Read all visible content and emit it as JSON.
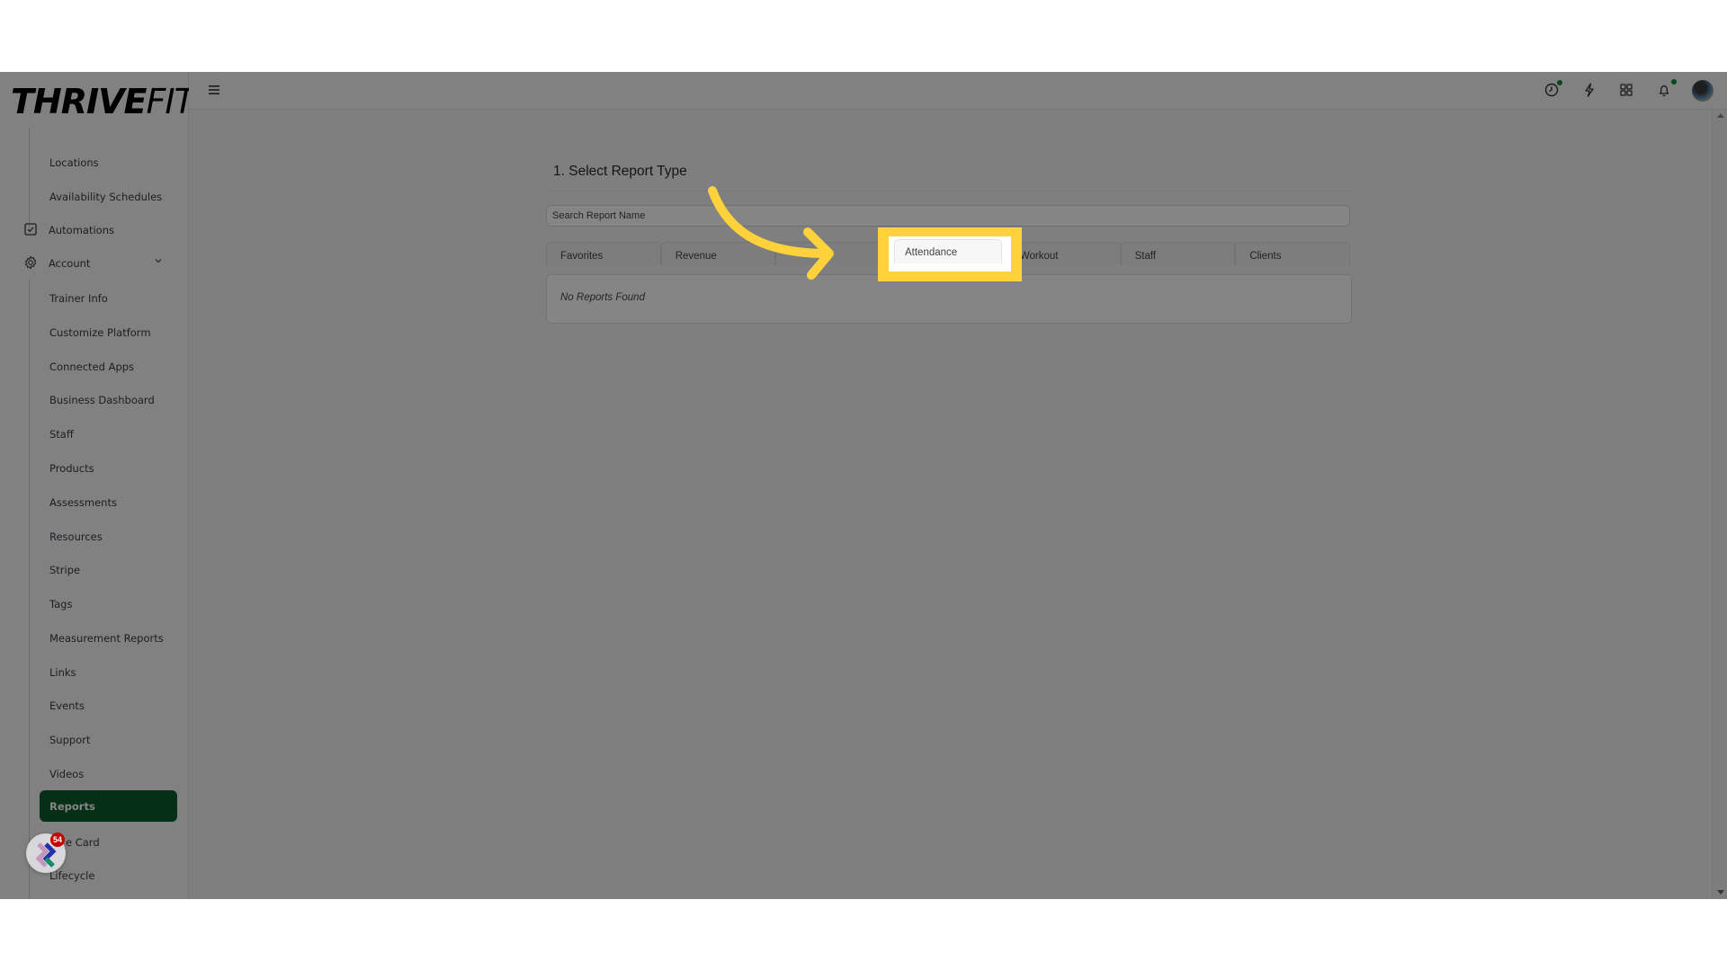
{
  "brand": {
    "name_bold": "THRIVE",
    "name_thin": "FIT"
  },
  "sidebar": {
    "items": [
      {
        "label": "Locations",
        "level": "sub"
      },
      {
        "label": "Availability Schedules",
        "level": "sub"
      },
      {
        "label": "Automations",
        "level": "top",
        "icon": "checkbox-icon"
      },
      {
        "label": "Account",
        "level": "top",
        "icon": "gear-icon",
        "expanded": true
      },
      {
        "label": "Trainer Info",
        "level": "sub"
      },
      {
        "label": "Customize Platform",
        "level": "sub"
      },
      {
        "label": "Connected Apps",
        "level": "sub"
      },
      {
        "label": "Business Dashboard",
        "level": "sub"
      },
      {
        "label": "Staff",
        "level": "sub"
      },
      {
        "label": "Products",
        "level": "sub"
      },
      {
        "label": "Assessments",
        "level": "sub"
      },
      {
        "label": "Resources",
        "level": "sub"
      },
      {
        "label": "Stripe",
        "level": "sub"
      },
      {
        "label": "Tags",
        "level": "sub"
      },
      {
        "label": "Measurement Reports",
        "level": "sub"
      },
      {
        "label": "Links",
        "level": "sub"
      },
      {
        "label": "Events",
        "level": "sub"
      },
      {
        "label": "Support",
        "level": "sub"
      },
      {
        "label": "Videos",
        "level": "sub"
      },
      {
        "label": "Reports",
        "level": "sub",
        "active": true
      },
      {
        "label": "e Card",
        "level": "sub"
      },
      {
        "label": "Lifecycle",
        "level": "sub"
      }
    ],
    "active_color": "#0c5a2e"
  },
  "header": {
    "icons": [
      "menu-icon",
      "clock-icon",
      "lightning-icon",
      "apps-grid-icon",
      "bell-icon",
      "avatar"
    ],
    "notification_dot_color": "#0c8a3a"
  },
  "main": {
    "section_title": "1. Select Report Type",
    "search": {
      "placeholder": "Search Report Name",
      "value": ""
    },
    "tabs": [
      {
        "label": "Favorites"
      },
      {
        "label": "Revenue"
      },
      {
        "label": ""
      },
      {
        "label": "Attendance",
        "highlighted": true
      },
      {
        "label": "Workout"
      },
      {
        "label": "Staff"
      },
      {
        "label": "Clients"
      }
    ],
    "empty_message": "No Reports Found"
  },
  "annotation": {
    "highlight_color": "#ffd23c",
    "target": "Attendance"
  },
  "chat_widget": {
    "badge_count": "54"
  }
}
